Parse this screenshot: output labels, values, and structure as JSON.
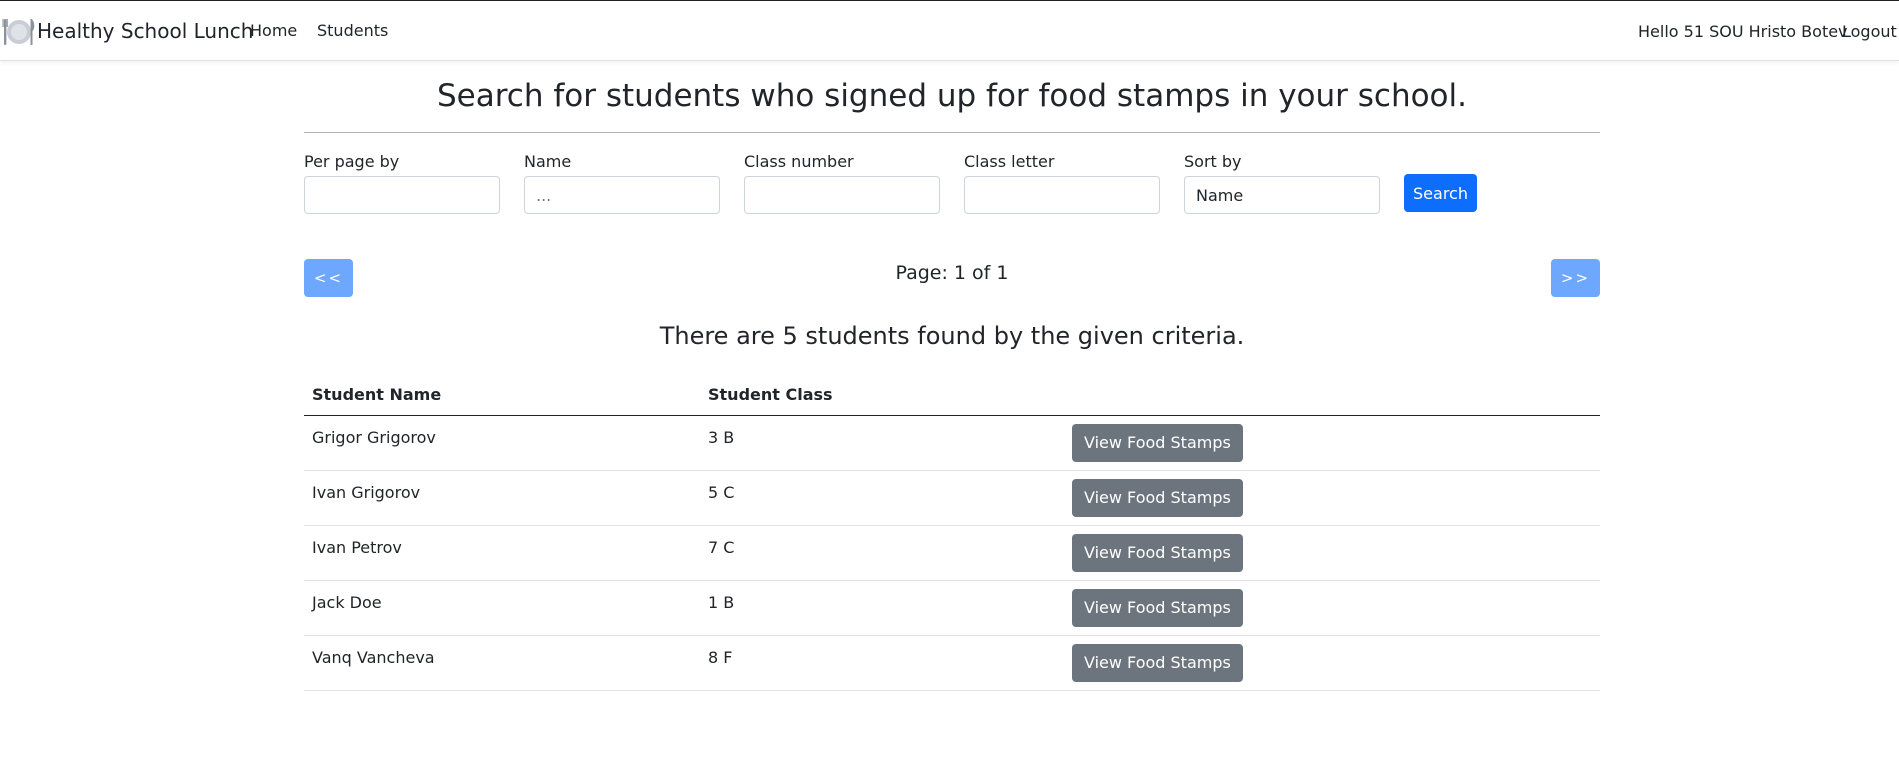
{
  "navbar": {
    "brand": "Healthy School Lunch",
    "brand_icon": "plate-cutlery-icon",
    "links": [
      "Home",
      "Students"
    ],
    "greeting": "Hello 51 SOU Hristo Botev",
    "logout": "Logout"
  },
  "page": {
    "title": "Search for students who signed up for food stamps in your school."
  },
  "filters": {
    "per_page": {
      "label": "Per page by",
      "value": "",
      "placeholder": ""
    },
    "name": {
      "label": "Name",
      "value": "",
      "placeholder": "..."
    },
    "class_number": {
      "label": "Class number",
      "value": "",
      "placeholder": ""
    },
    "class_letter": {
      "label": "Class letter",
      "value": "",
      "placeholder": ""
    },
    "sort_by": {
      "label": "Sort by",
      "value": "Name",
      "placeholder": ""
    },
    "search_label": "Search"
  },
  "pagination": {
    "prev_label": "<<",
    "next_label": ">>",
    "indicator": "Page: 1 of 1"
  },
  "results": {
    "summary": "There are 5 students found by the given criteria.",
    "columns": [
      "Student Name",
      "Student Class",
      ""
    ],
    "action_label": "View Food Stamps",
    "rows": [
      {
        "name": "Grigor Grigorov",
        "class": "3 B"
      },
      {
        "name": "Ivan Grigorov",
        "class": "5 C"
      },
      {
        "name": "Ivan Petrov",
        "class": "7 C"
      },
      {
        "name": "Jack Doe",
        "class": "1 B"
      },
      {
        "name": "Vanq Vancheva",
        "class": "8 F"
      }
    ]
  },
  "colors": {
    "primary": "#0d6efd",
    "primary_light": "#6ea8fe",
    "secondary": "#6c757d"
  }
}
